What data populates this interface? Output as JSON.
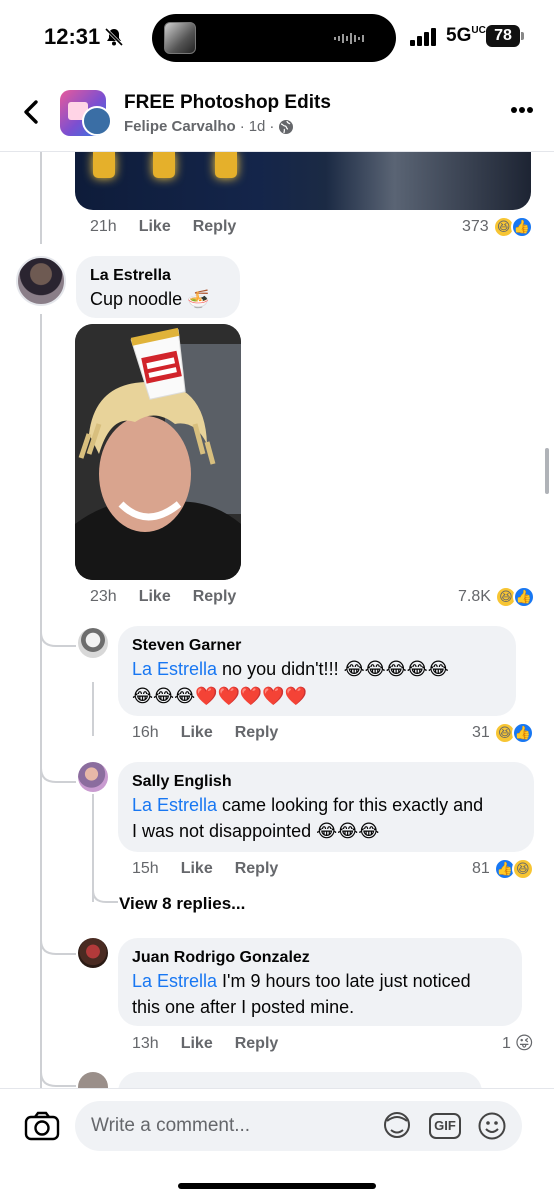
{
  "status": {
    "time": "12:31",
    "network": "5G",
    "network_sub": "UC",
    "battery": "78"
  },
  "header": {
    "title": "FREE Photoshop Edits",
    "author": "Felipe Carvalho",
    "age": "1d",
    "separator": "·"
  },
  "top_comment": {
    "time": "21h",
    "like": "Like",
    "reply": "Reply",
    "reactions": "373"
  },
  "comment1": {
    "name": "La Estrella",
    "text": "Cup noodle",
    "emoji": "🍜",
    "time": "23h",
    "like": "Like",
    "reply": "Reply",
    "reactions": "7.8K"
  },
  "reply1": {
    "name": "Steven Garner",
    "mention": "La Estrella",
    "text": " no you didn't!!! ",
    "emojis_line1": "😂😂😂😂😂",
    "emojis_line2": "😂😂😂❤️❤️❤️❤️❤️",
    "time": "16h",
    "like": "Like",
    "reply": "Reply",
    "reactions": "31"
  },
  "reply2": {
    "name": "Sally English",
    "mention": "La Estrella",
    "text_line1": " came looking for this exactly and",
    "text_line2": "I was not disappointed ",
    "emojis": "😂😂😂",
    "time": "15h",
    "like": "Like",
    "reply": "Reply",
    "reactions": "81"
  },
  "view_replies": "View 8 replies...",
  "reply3": {
    "name": "Juan Rodrigo Gonzalez",
    "mention": "La Estrella",
    "text_line1": " I'm 9 hours too late just noticed",
    "text_line2": "this one after I posted mine.",
    "time": "13h",
    "like": "Like",
    "reply": "Reply",
    "reactions": "1",
    "reaction_emoji": "😜"
  },
  "composer": {
    "placeholder": "Write a comment...",
    "gif": "GIF"
  },
  "colors": {
    "link": "#1877f2",
    "bubble": "#f0f2f5",
    "meta": "#65676b"
  }
}
